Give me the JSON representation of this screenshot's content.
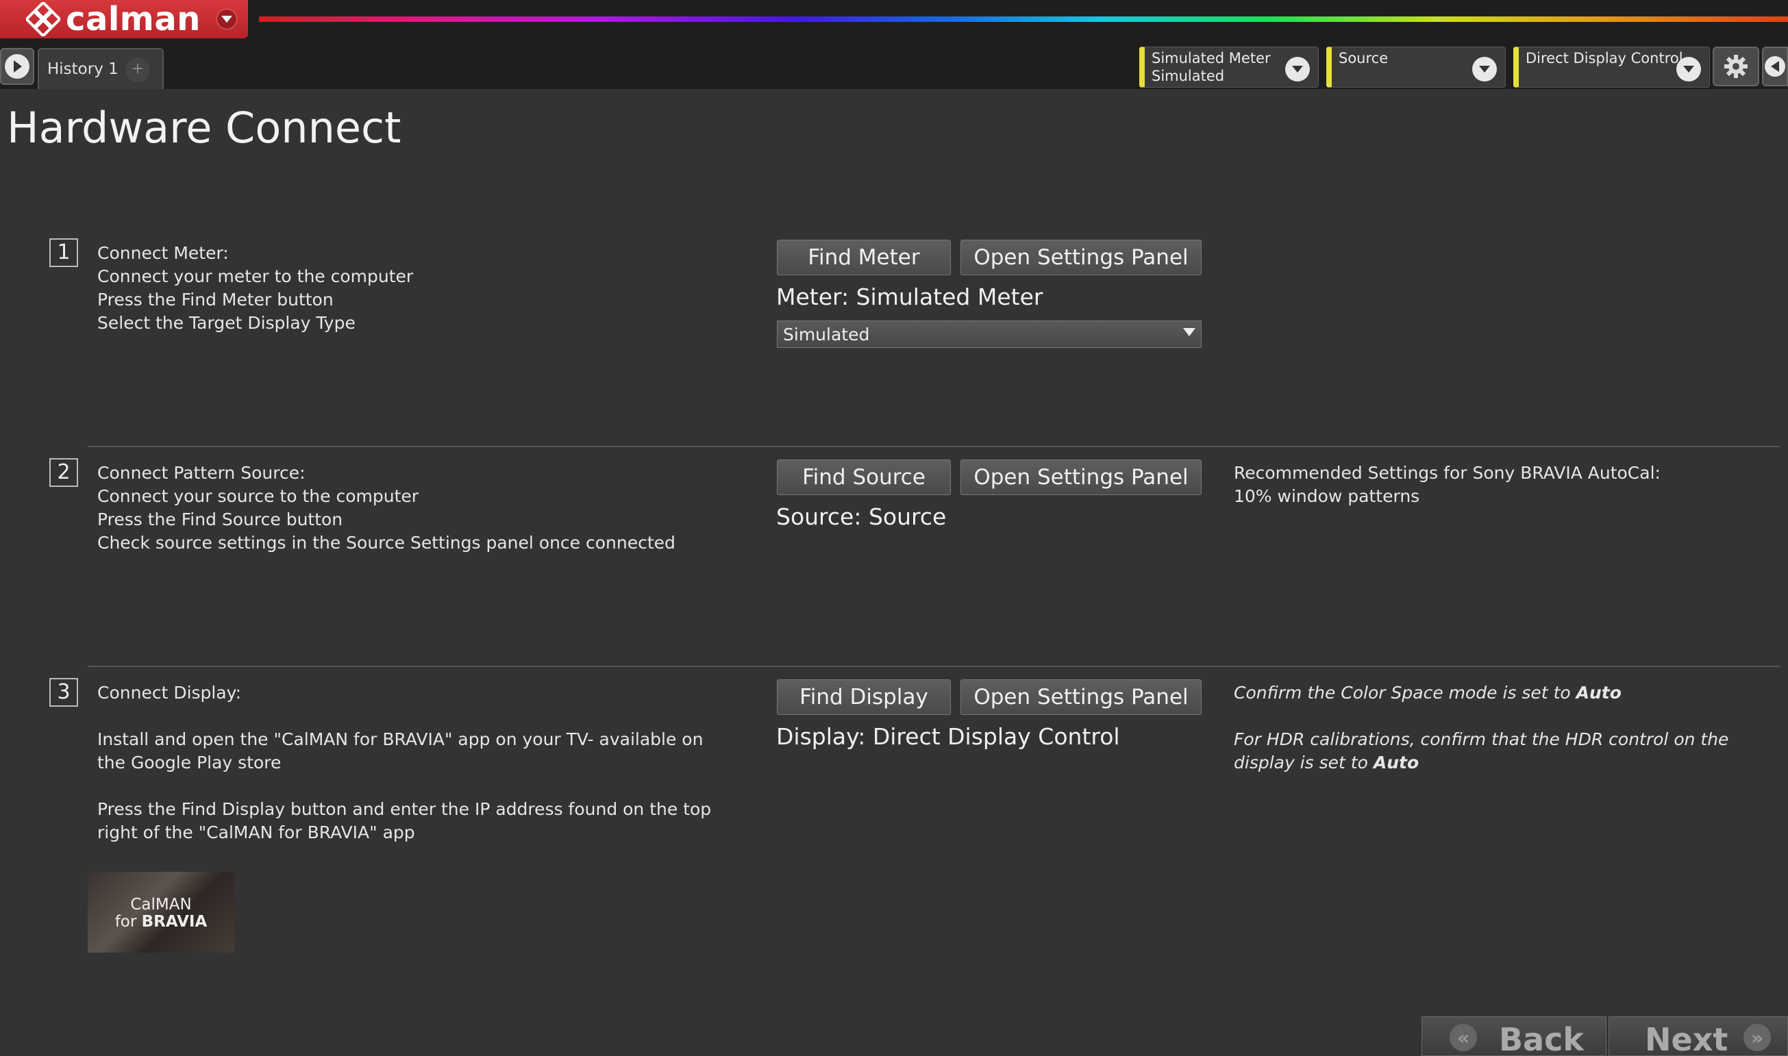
{
  "app": {
    "logo_text": "calman",
    "history_tab": "History 1",
    "history_add": "+"
  },
  "devices": {
    "meter": {
      "line1": "Simulated Meter",
      "line2": "Simulated"
    },
    "source": {
      "line1": "Source"
    },
    "display": {
      "line1": "Direct Display Control"
    }
  },
  "page": {
    "title": "Hardware Connect"
  },
  "steps": [
    {
      "number": "1",
      "lines": [
        "Connect Meter:",
        "Connect your meter to the computer",
        "Press the Find Meter button",
        "Select the Target Display Type"
      ],
      "find_label": "Find Meter",
      "settings_label": "Open Settings Panel",
      "status": "Meter: Simulated Meter",
      "select_value": "Simulated"
    },
    {
      "number": "2",
      "lines": [
        "Connect Pattern Source:",
        "Connect your source to the computer",
        "Press the Find Source button",
        "Check source settings in the Source Settings panel once connected"
      ],
      "find_label": "Find Source",
      "settings_label": "Open Settings Panel",
      "status": "Source: Source",
      "note_lines": [
        "Recommended Settings for Sony BRAVIA AutoCal:",
        "10% window patterns"
      ]
    },
    {
      "number": "3",
      "title": "Connect Display:",
      "para1": "Install and open the \"CalMAN for BRAVIA\" app on your TV-  available on the Google Play store",
      "para2": "Press the Find Display button and enter the IP address found on the top right of the \"CalMAN for BRAVIA\" app",
      "find_label": "Find Display",
      "settings_label": "Open Settings Panel",
      "status": "Display: Direct Display Control",
      "note1_prefix": "Confirm the Color Space mode is set to ",
      "note1_bold": "Auto",
      "note2_prefix": "For HDR calibrations, confirm that the HDR control on the display is set to ",
      "note2_bold": "Auto",
      "app_badge_line1": "CalMAN",
      "app_badge_line2_prefix": "for ",
      "app_badge_line2_bold": "BRAVIA"
    }
  ],
  "nav": {
    "back": "Back",
    "next": "Next"
  },
  "colors": {
    "brand_red": "#c92d32",
    "device_accent": "#e6e03a",
    "background": "#333333"
  }
}
